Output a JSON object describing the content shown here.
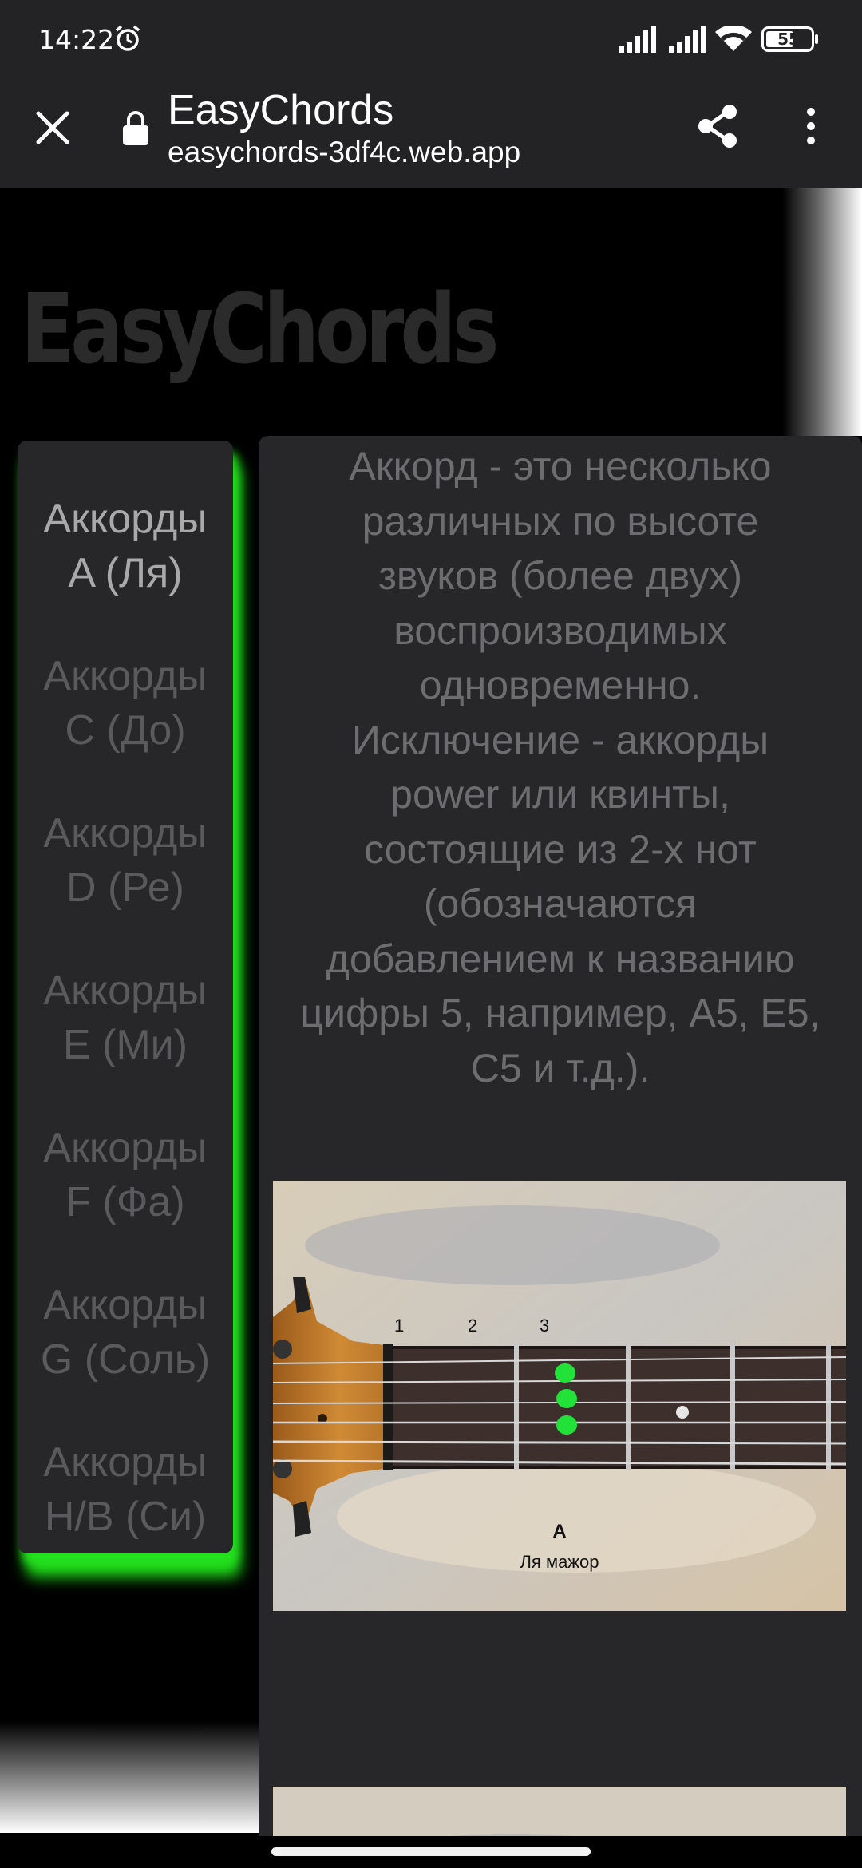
{
  "status_bar": {
    "time": "14:22",
    "battery": "55"
  },
  "browser": {
    "title": "EasyChords",
    "url": "easychords-3df4c.web.app"
  },
  "page": {
    "logo": "EasyChords",
    "sidebar": {
      "items": [
        {
          "line1": "Аккорды",
          "line2": "A (Ля)",
          "active": true
        },
        {
          "line1": "Аккорды",
          "line2": "C (До)"
        },
        {
          "line1": "Аккорды",
          "line2": "D (Ре)"
        },
        {
          "line1": "Аккорды",
          "line2": "E (Ми)"
        },
        {
          "line1": "Аккорды",
          "line2": "F (Фа)"
        },
        {
          "line1": "Аккорды",
          "line2": "G (Соль)"
        },
        {
          "line1": "Аккорды",
          "line2": "H/B (Си)"
        }
      ]
    },
    "description_lines": [
      "Аккорд - это несколько",
      "различных по высоте",
      "звуков (более двух)",
      "воспроизводимых",
      "одновременно.",
      "Исключение - аккорды",
      "power или квинты,",
      "состоящие из 2-х нот",
      "(обозначаются",
      "добавлением к названию",
      "цифры 5, например, A5, E5,",
      "C5 и т.д.)."
    ],
    "chord_image": {
      "fret_numbers": [
        "1",
        "2",
        "3"
      ],
      "chord": "A",
      "chord_name": "Ля мажор"
    }
  },
  "colors": {
    "accent_glow": "#25e01f",
    "panel": "#27272a",
    "chrome": "#232325"
  }
}
